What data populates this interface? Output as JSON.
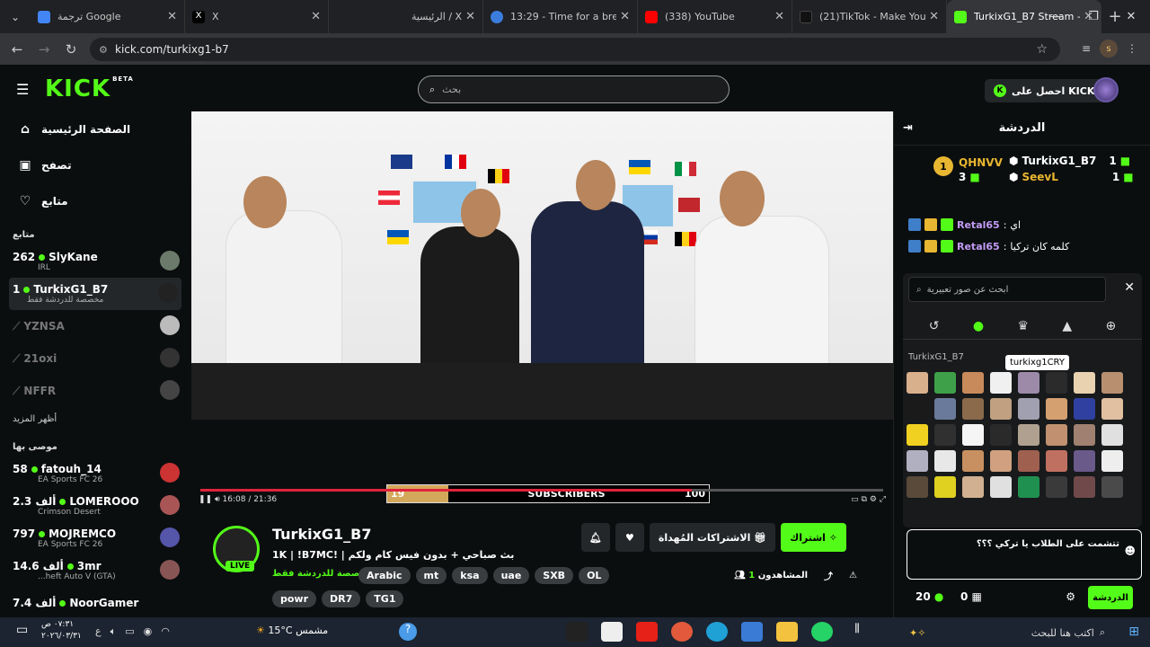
{
  "browser": {
    "tabs": [
      {
        "title": "ترجمة Google",
        "color": "#4285f4"
      },
      {
        "title": "X",
        "color": "#000000"
      },
      {
        "title": "X / الرئيسية",
        "color": "#222222"
      },
      {
        "title": "13:29 - Time for a break!",
        "color": "#3b7ddd"
      },
      {
        "title": "(338) YouTube",
        "color": "#ff0000"
      },
      {
        "title": "(21)TikTok - Make Your Day",
        "color": "#111111"
      },
      {
        "title": "TurkixG1_B7 Stream - Watch",
        "color": "#53fc18"
      }
    ],
    "url": "kick.com/turkixg1-b7",
    "profile_initial": "s"
  },
  "header": {
    "logo": "KICK",
    "logo_badge": "BETA",
    "search_placeholder": "بحث",
    "get_kicks": "احصل على KICKs"
  },
  "sidebar": {
    "nav": [
      {
        "label": "الصفحة الرئيسية",
        "icon": "home-icon"
      },
      {
        "label": "تصفح",
        "icon": "browse-icon"
      },
      {
        "label": "متابع",
        "icon": "heart-icon"
      }
    ],
    "following_title": "متابع",
    "following": [
      {
        "count": "262",
        "name": "SlyKane",
        "sub": "IRL",
        "online": true
      },
      {
        "count": "1",
        "name": "TurkixG1_B7",
        "sub": "مخصصة للدردشة فقط",
        "online": true
      },
      {
        "count": "",
        "name": "YZNSA",
        "sub": "",
        "online": false
      },
      {
        "count": "",
        "name": "21oxi",
        "sub": "",
        "online": false
      },
      {
        "count": "",
        "name": "NFFR",
        "sub": "",
        "online": false
      }
    ],
    "show_more": "أظهر المزيد",
    "recommended_title": "موصى بها",
    "recommended": [
      {
        "count": "58",
        "name": "fatouh_14",
        "sub": "EA Sports FC 26"
      },
      {
        "count": "2.3 ألف",
        "name": "LOMEROOO",
        "sub": "Crimson Desert"
      },
      {
        "count": "797",
        "name": "MOJREMCO",
        "sub": "EA Sports FC 26"
      },
      {
        "count": "14.6 ألف",
        "name": "3mr",
        "sub": "...heft Auto V (GTA)"
      },
      {
        "count": "7.4 ألف",
        "name": "NoorGamer",
        "sub": ""
      }
    ]
  },
  "player": {
    "sub_goal_current": "19",
    "sub_goal_label": "SUBSCRIBERS",
    "sub_goal_target": "100",
    "sub_goal_fraction": 0.19,
    "time": "16:08 / 21:36",
    "progress_fraction": 0.72
  },
  "stream": {
    "name": "TurkixG1_B7",
    "live": "LIVE",
    "title": "بث صباحي + بدون فيس كام ولكم | !1K | !B7MC",
    "category": "مخصصة للدردشة فقط",
    "tags": [
      "Arabic",
      "mt",
      "ksa",
      "uae",
      "SXB",
      "OL",
      "powr",
      "DR7",
      "TG1"
    ],
    "subscribe": "اشتراك",
    "gift": "الاشتراكات المُهداة",
    "viewers_label": "المشاهدون",
    "viewers": "1"
  },
  "chat": {
    "title": "الدردشة",
    "leaders": [
      {
        "rank": "1",
        "name": "TurkixG1_B7",
        "count": "1"
      },
      {
        "rank": "",
        "name": "SeevL",
        "count": "1"
      },
      {
        "rank": "",
        "name": "QHNVV",
        "count": "3"
      }
    ],
    "messages": [
      {
        "user": "Retal65",
        "text": "اي"
      },
      {
        "user": "Retal65",
        "text": "كلمه كان تركيا"
      }
    ],
    "emote_search": "ابحث عن صور تعبيرية",
    "emote_set_title": "TurkixG1_B7",
    "tooltip": "turkixg1CRY",
    "input_text": "تتشمت على الطلاب يا تركي ؟؟؟",
    "send": "الدردشة",
    "points": "20",
    "sub_count": "0"
  },
  "taskbar": {
    "time": "٠٧:٣١ ص",
    "date": "٢٠٢٦/٠٣/٣١",
    "weather": "15°C مشمس",
    "search": "اكتب هنا للبحث"
  }
}
